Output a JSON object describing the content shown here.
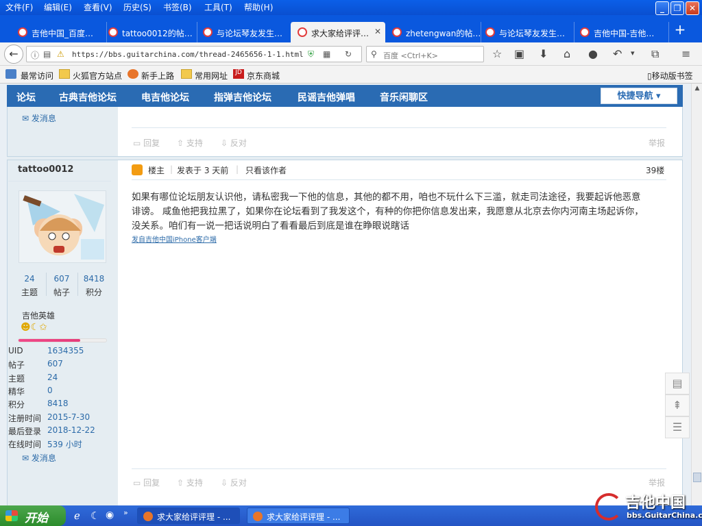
{
  "menu": [
    "文件(F)",
    "编辑(E)",
    "查看(V)",
    "历史(S)",
    "书签(B)",
    "工具(T)",
    "帮助(H)"
  ],
  "window_buttons": {
    "minimize": "_",
    "maximize": "❐",
    "close": "✕"
  },
  "tabs": [
    {
      "label": "吉他中国_百度…"
    },
    {
      "label": "tattoo0012的帖…"
    },
    {
      "label": "与论坛琴友发生…"
    },
    {
      "label": "求大家给评评…",
      "active": true
    },
    {
      "label": "zhetengwan的帖…"
    },
    {
      "label": "与论坛琴友发生…"
    },
    {
      "label": "吉他中国-吉他…"
    }
  ],
  "new_tab": "+",
  "nav": {
    "url": "https://bbs.guitarchina.com/thread-2465656-1-1.html",
    "search_placeholder": "百度 <Ctrl+K>",
    "icons": [
      "back-icon",
      "info-icon",
      "reader-icon",
      "shield-icon",
      "qr-icon",
      "reload-icon",
      "search-icon",
      "star-icon",
      "library-icon",
      "download-icon",
      "home-icon",
      "chat-icon",
      "undo-icon",
      "screenshot-icon",
      "menu-icon"
    ]
  },
  "bookmarks": [
    "最常访问",
    "火狐官方站点",
    "新手上路",
    "常用网址",
    "京东商城"
  ],
  "mobile_bookmarks": "移动版书签",
  "forum_nav": {
    "items": [
      "论坛",
      "古典吉他论坛",
      "电吉他论坛",
      "指弹吉他论坛",
      "民谣吉他弹唱",
      "音乐闲聊区"
    ],
    "quick_nav": "快捷导航 ▾"
  },
  "prev_post": {
    "send_msg": "发消息",
    "reply": "回复",
    "support": "支持",
    "oppose": "反对",
    "report": "举报"
  },
  "post": {
    "author": "tattoo0012",
    "role": "楼主",
    "posted": "发表于 3 天前",
    "only_author": "只看该作者",
    "floor": "39楼",
    "stats": [
      {
        "value": "24",
        "label": "主题"
      },
      {
        "value": "607",
        "label": "帖子"
      },
      {
        "value": "8418",
        "label": "积分"
      }
    ],
    "rank": "吉他英雄",
    "rank_progress": 0.7,
    "content_lines": [
      "如果有哪位论坛朋友认识他，请私密我一下他的信息，其他的都不用，咱也不玩什么下三滥，就走司法途径，我要起诉他恶意",
      "诽谤。 咸鱼他把我拉黑了，如果你在论坛看到了我发这个，有种的你把你信息发出来，我愿意从北京去你内河南主场起诉你，",
      "没关系。咱们有一说一把话说明白了看看最后到底是谁在睁眼说瞎话"
    ],
    "source": "发自吉他中国iPhone客户端",
    "profile": [
      {
        "label": "UID",
        "value": "1634355"
      },
      {
        "label": "帖子",
        "value": "607"
      },
      {
        "label": "主题",
        "value": "24"
      },
      {
        "label": "精华",
        "value": "0"
      },
      {
        "label": "积分",
        "value": "8418"
      },
      {
        "label": "注册时间",
        "value": "2015-7-30"
      },
      {
        "label": "最后登录",
        "value": "2018-12-22"
      },
      {
        "label": "在线时间",
        "value": "539 小时"
      }
    ],
    "send_msg": "发消息",
    "reply": "回复",
    "support": "支持",
    "oppose": "反对",
    "report": "举报"
  },
  "taskbar": {
    "start": "开始",
    "tasks": [
      "求大家给评评理 - ...",
      "求大家给评评理 - ..."
    ]
  },
  "watermark": {
    "title": "吉他中国",
    "url": "bbs.GuitarChina.com"
  },
  "colors": {
    "titlebar": "#0a58de",
    "forum_nav": "#2a6bb3",
    "link": "#2b6aa8",
    "taskbar": "#2454c4"
  }
}
